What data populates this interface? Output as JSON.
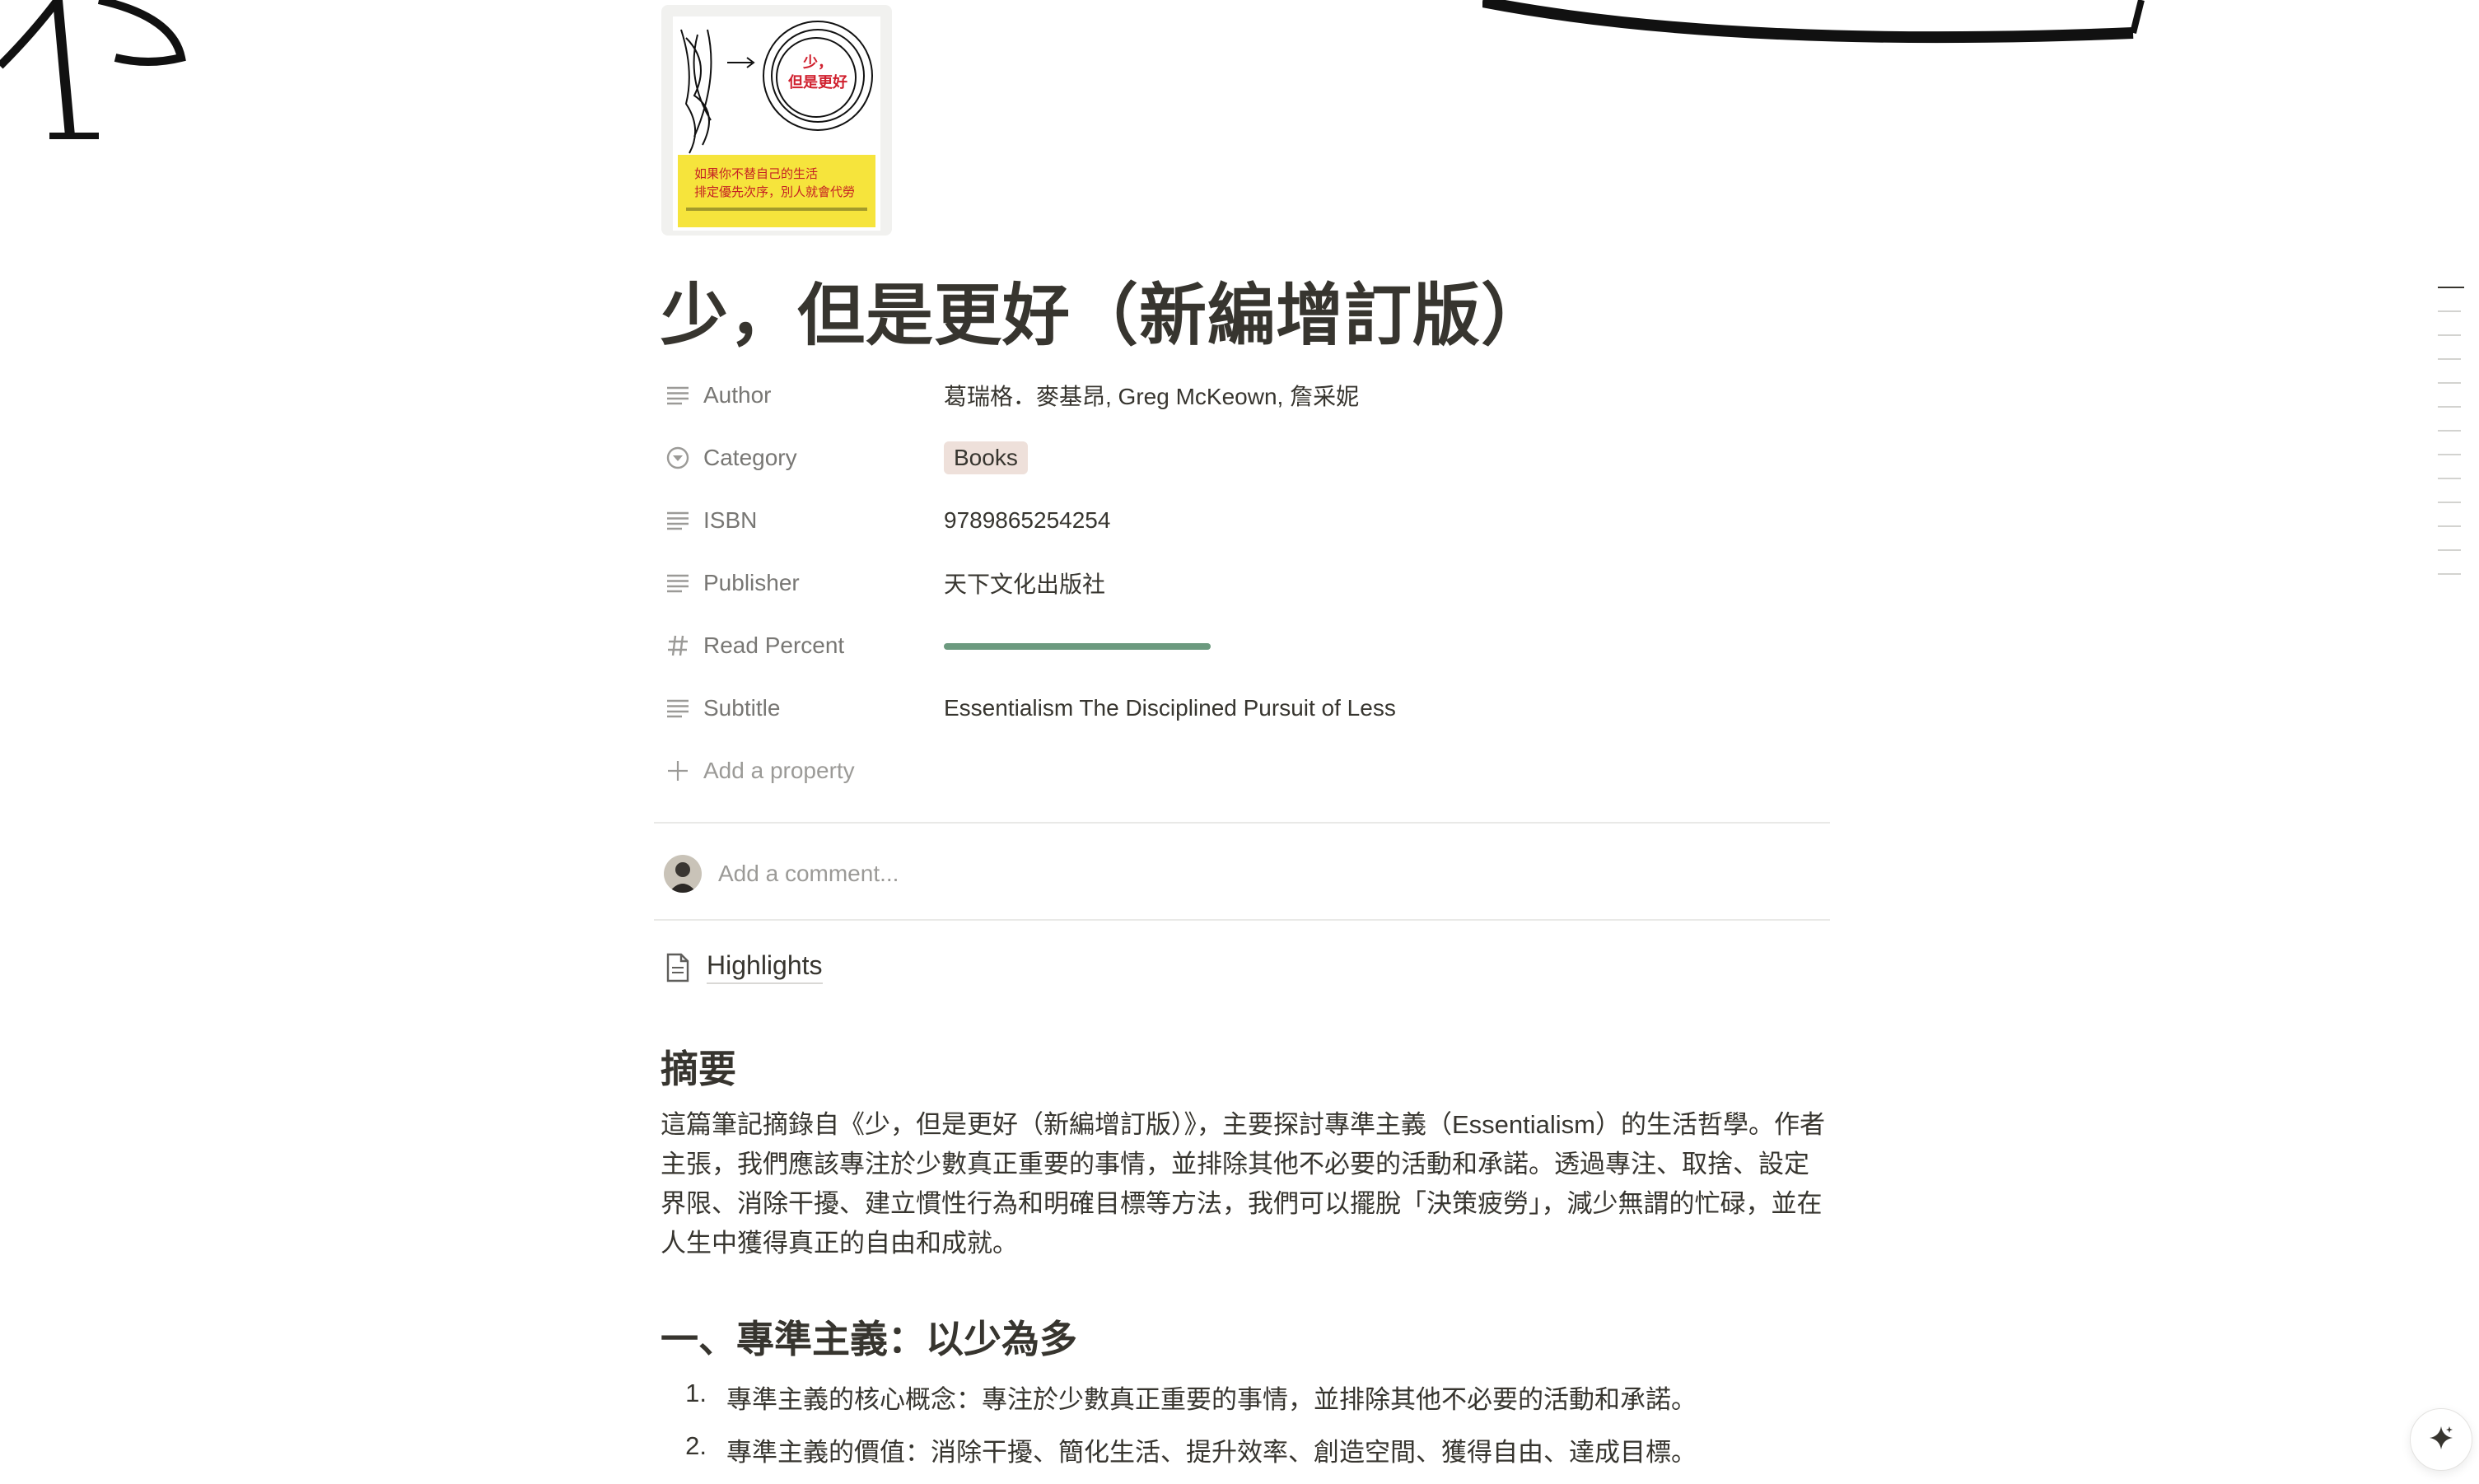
{
  "page": {
    "title": "少，但是更好（新編增訂版）"
  },
  "book_cover": {
    "title_text": "少，但是更好",
    "tagline_1": "如果你不替自己的生活",
    "tagline_2": "排定優先次序，別人就會代勞"
  },
  "properties": [
    {
      "name": "Author",
      "icon": "text-lines-icon",
      "value": "葛瑞格．麥基昂, Greg McKeown, 詹采妮"
    },
    {
      "name": "Category",
      "icon": "select-circle-icon",
      "value": "Books",
      "tag_color": "#eee0da"
    },
    {
      "name": "ISBN",
      "icon": "text-lines-icon",
      "value": "9789865254254"
    },
    {
      "name": "Publisher",
      "icon": "text-lines-icon",
      "value": "天下文化出版社"
    },
    {
      "name": "Read Percent",
      "icon": "hash-icon",
      "progress": 1.0,
      "progress_color": "#6c9a7f"
    },
    {
      "name": "Subtitle",
      "icon": "text-lines-icon",
      "value": "Essentialism The Disciplined Pursuit of Less"
    }
  ],
  "add_property_label": "Add a property",
  "comment": {
    "placeholder": "Add a comment..."
  },
  "subpage": {
    "label": "Highlights",
    "icon": "document-icon"
  },
  "summary": {
    "heading": "摘要",
    "body": "這篇筆記摘錄自《少，但是更好（新編增訂版）》，主要探討專準主義（Essentialism）的生活哲學。作者主張，我們應該專注於少數真正重要的事情，並排除其他不必要的活動和承諾。透過專注、取捨、設定界限、消除干擾、建立慣性行為和明確目標等方法，我們可以擺脫「決策疲勞」，減少無謂的忙碌，並在人生中獲得真正的自由和成就。"
  },
  "section1": {
    "heading": "一、專準主義：以少為多",
    "items": [
      {
        "num": "1.",
        "text": "專準主義的核心概念：專注於少數真正重要的事情，並排除其他不必要的活動和承諾。"
      },
      {
        "num": "2.",
        "text": "專準主義的價值：消除干擾、簡化生活、提升效率、創造空間、獲得自由、達成目標。"
      }
    ]
  },
  "colors": {
    "text": "#37352f",
    "muted": "#787774",
    "tag_bg": "#eee0da",
    "progress": "#6c9a7f"
  }
}
